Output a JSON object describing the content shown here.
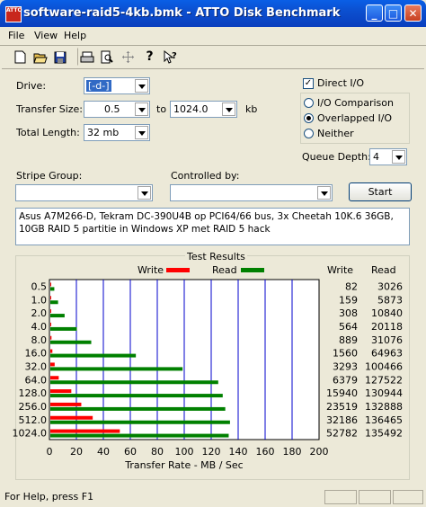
{
  "window": {
    "app_icon_text": "ATTO",
    "title": "software-raid5-4kb.bmk - ATTO Disk Benchmark",
    "minimize": "_",
    "maximize": "□",
    "close": "✕"
  },
  "menu": [
    "File",
    "View",
    "Help"
  ],
  "toolbar": [
    "new-icon",
    "open-icon",
    "save-icon",
    "print-icon",
    "print-preview-icon",
    "move-icon",
    "help-icon",
    "context-help-icon"
  ],
  "form": {
    "drive_label": "Drive:",
    "drive_value": "[-d-]",
    "transfer_size_label": "Transfer Size:",
    "transfer_from": "0.5",
    "to_label": "to",
    "transfer_to": "1024.0",
    "kb_label": "kb",
    "total_length_label": "Total Length:",
    "total_length_value": "32 mb",
    "direct_io_label": "Direct I/O",
    "direct_io_checked": true,
    "io_comparison_label": "I/O Comparison",
    "overlapped_io_label": "Overlapped I/O",
    "neither_label": "Neither",
    "selected_mode": "Overlapped I/O",
    "queue_depth_label": "Queue Depth:",
    "queue_depth_value": "4",
    "stripe_group_label": "Stripe Group:",
    "stripe_group_value": "",
    "controlled_by_label": "Controlled by:",
    "controlled_by_value": "",
    "start_label": "Start",
    "description": "Asus A7M266-D, Tekram DC-390U4B op PCI64/66 bus, 3x Cheetah 10K.6 36GB, 10GB RAID 5 partitie in Windows XP met RAID 5 hack"
  },
  "results": {
    "title": "Test Results",
    "legend_write": "Write",
    "legend_read": "Read",
    "col_write": "Write",
    "col_read": "Read"
  },
  "chart_data": {
    "type": "bar",
    "orientation": "horizontal",
    "categories": [
      "0.5",
      "1.0",
      "2.0",
      "4.0",
      "8.0",
      "16.0",
      "32.0",
      "64.0",
      "128.0",
      "256.0",
      "512.0",
      "1024.0"
    ],
    "series": [
      {
        "name": "Write",
        "color": "#FF0000",
        "values": [
          82,
          159,
          308,
          564,
          889,
          1560,
          3293,
          6379,
          15940,
          23519,
          32186,
          52782
        ]
      },
      {
        "name": "Read",
        "color": "#008000",
        "values": [
          3026,
          5873,
          10840,
          20118,
          31076,
          64963,
          100466,
          127522,
          130944,
          132888,
          136465,
          135492
        ]
      }
    ],
    "xlabel": "Transfer Rate - MB / Sec",
    "xlim": [
      0,
      200
    ],
    "xticks": [
      "0",
      "20",
      "40",
      "60",
      "80",
      "100",
      "120",
      "140",
      "160",
      "180",
      "200"
    ],
    "grid": true,
    "grid_color": "#0000CC",
    "legend": "top"
  },
  "status": {
    "text": "For Help, press F1"
  }
}
